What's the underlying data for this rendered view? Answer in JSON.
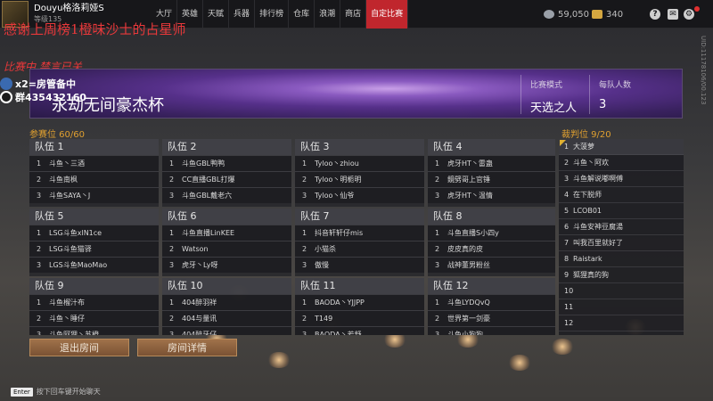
{
  "topbar": {
    "username": "Douyu格洛莉娅S",
    "user_sub": "等级135",
    "nav": [
      "大厅",
      "英雄",
      "天赋",
      "兵器",
      "排行榜",
      "仓库",
      "浪潮",
      "商店",
      "自定比赛"
    ],
    "active_nav": "自定比赛",
    "silver": "59,050",
    "gold": "340",
    "icons": [
      "help-icon",
      "mail-icon",
      "settings-icon"
    ]
  },
  "overlay": {
    "line1": "感谢上周榜1橙味沙士的占星师",
    "line2": "比赛中 禁言已关",
    "line3": "x2=房管备中",
    "line4": "群435432160"
  },
  "banner": {
    "title": "永劫无间豪杰杯",
    "mode_label": "比赛模式",
    "mode_value": "天选之人",
    "team_size_label": "每队人数",
    "team_size_value": "3"
  },
  "participants_label": "参赛位 60/60",
  "referees_label": "裁判位 9/20",
  "teams": [
    {
      "name": "队伍 1",
      "players": [
        "斗鱼丶三酒",
        "斗鱼南枫",
        "斗鱼SAYA丶J"
      ]
    },
    {
      "name": "队伍 2",
      "players": [
        "斗鱼GBL鸭鸭",
        "CC直播GBL打爆",
        "斗鱼GBL戴老六"
      ]
    },
    {
      "name": "队伍 3",
      "players": [
        "Tyloo丶zhiou",
        "Tyloo丶明栀明",
        "Tyloo丶仙爷"
      ]
    },
    {
      "name": "队伍 4",
      "players": [
        "虎牙HT丶雷蛊",
        "鏡劈哥上官锤",
        "虎牙HT丶温情"
      ]
    },
    {
      "name": "队伍 5",
      "players": [
        "LSG斗鱼xlN1ce",
        "LSG斗鱼猫驿",
        "LGS斗鱼MaoMao"
      ]
    },
    {
      "name": "队伍 6",
      "players": [
        "斗鱼直播LinKEE",
        "Watson",
        "虎牙丶Ly呀"
      ]
    },
    {
      "name": "队伍 7",
      "players": [
        "抖音轩轩仔mis",
        "小猫杀",
        "傲慢"
      ]
    },
    {
      "name": "队伍 8",
      "players": [
        "斗鱼直播S小四y",
        "皮皮真的皮",
        "战神董男粉丝"
      ]
    },
    {
      "name": "队伍 9",
      "players": [
        "斗鱼榴汁布",
        "斗鱼丶睡仔",
        "斗鱼阿狸丶苏橙"
      ]
    },
    {
      "name": "队伍 10",
      "players": [
        "404醉羽祥",
        "404与量讯",
        "404醉牙仔"
      ]
    },
    {
      "name": "队伍 11",
      "players": [
        "BAODA丶YJJPP",
        "T149",
        "BAODA丶若舒"
      ]
    },
    {
      "name": "队伍 12",
      "players": [
        "斗鱼LYDQvQ",
        "世界第一剑豪",
        "斗鱼小狗狗"
      ]
    }
  ],
  "referees": [
    {
      "n": "1",
      "name": "大菠萝"
    },
    {
      "n": "2",
      "name": "斗鱼丶阿欢"
    },
    {
      "n": "3",
      "name": "斗鱼解说嘟啊傅"
    },
    {
      "n": "4",
      "name": "在下脱师"
    },
    {
      "n": "5",
      "name": "LCOB01"
    },
    {
      "n": "6",
      "name": "斗鱼安神豆腐湯"
    },
    {
      "n": "7",
      "name": "叫我百里就好了"
    },
    {
      "n": "8",
      "name": "Raistark"
    },
    {
      "n": "9",
      "name": "狐狸真的狗"
    },
    {
      "n": "10",
      "name": ""
    },
    {
      "n": "11",
      "name": ""
    },
    {
      "n": "12",
      "name": ""
    }
  ],
  "buttons": {
    "exit": "退出房间",
    "details": "房间详情"
  },
  "chat": {
    "key": "Enter",
    "hint": "按下回车键开始聊天"
  },
  "side_text": "UID:11178106/00.123"
}
